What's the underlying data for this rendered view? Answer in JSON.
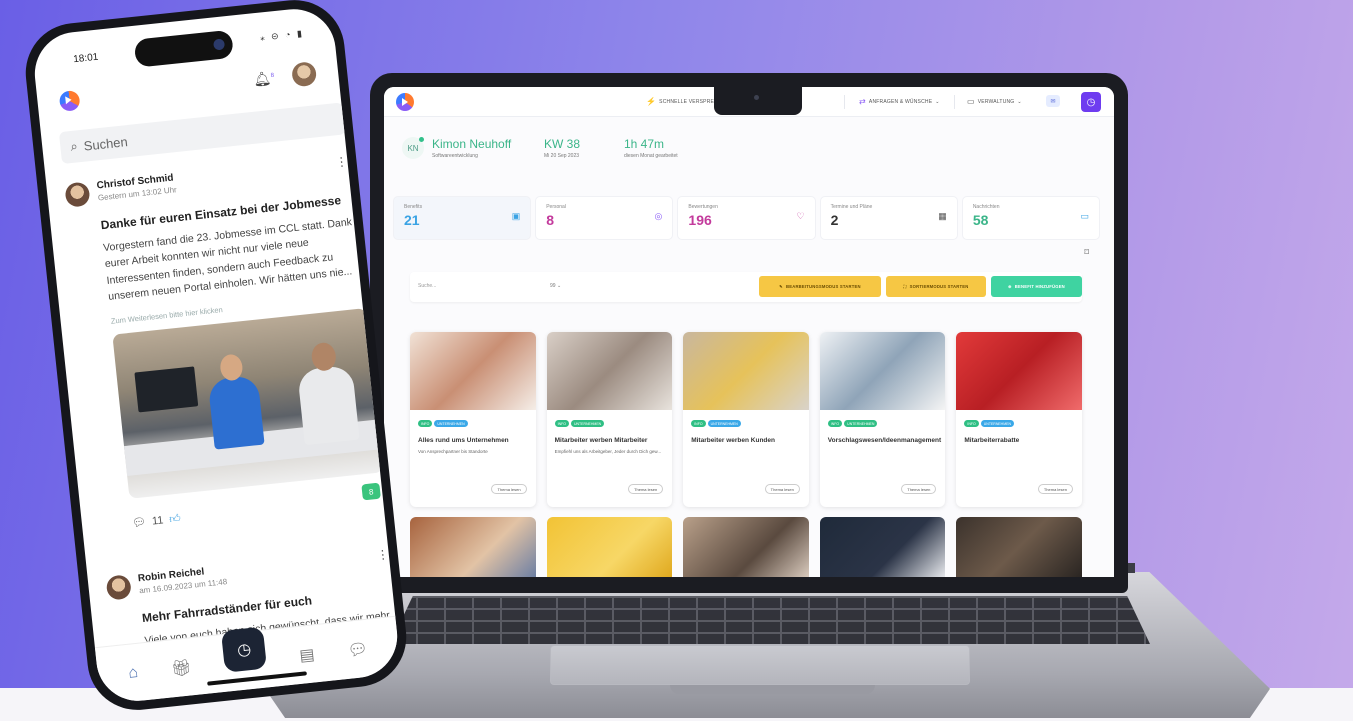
{
  "laptop": {
    "topbar": {
      "item1": "SCHNELLE VERSPRECHEN",
      "item2": "ANFRAGEN & WÜNSCHE",
      "item3": "VERWALTUNG",
      "item3_chevron": "⌄",
      "item2_chevron": "⌄",
      "btn_icon": "clock-icon"
    },
    "profile": {
      "initials": "KN",
      "name": "Kimon Neuhoff",
      "role": "Softwareentwicklung",
      "week": "KW 38",
      "date": "Mi 20 Sep 2023",
      "hours": "1h 47m",
      "hours_label": "diesen Monat gearbeitet"
    },
    "stats": [
      {
        "label": "Benefits",
        "value": "21",
        "color": "#3aa3e4",
        "icon": "gift-icon"
      },
      {
        "label": "Personal",
        "value": "8",
        "color": "#c33a9c",
        "icon": "person-icon"
      },
      {
        "label": "Bewertungen",
        "value": "196",
        "color": "#c33a9c",
        "icon": "heart-icon"
      },
      {
        "label": "Termine und Pläne",
        "value": "2",
        "color": "#333333",
        "icon": "calendar-icon"
      },
      {
        "label": "Nachrichten",
        "value": "58",
        "color": "#3bb589",
        "icon": "chat-icon"
      }
    ],
    "toolbar": {
      "search_placeholder": "Suche...",
      "select_label": "99 ⌄",
      "btn_edit": "BEARBEITUNGSMODUS STARTEN",
      "btn_sort": "SORTIERMODUS STARTEN",
      "btn_add": "BENEFIT HINZUFÜGEN"
    },
    "cards": [
      {
        "title": "Alles rund ums Unternehmen",
        "desc": "Von Ansprechpartner bis Standorte",
        "btn": "Thema lesen"
      },
      {
        "title": "Mitarbeiter werben Mitarbeiter",
        "desc": "Empfiehl uns als Arbeitgeber, Jeder durch Dich gew...",
        "btn": "Thema lesen"
      },
      {
        "title": "Mitarbeiter werben Kunden",
        "desc": "",
        "btn": "Thema lesen"
      },
      {
        "title": "Vorschlagswesen/Ideenmanagement",
        "desc": "",
        "btn": "Thema lesen"
      },
      {
        "title": "Mitarbeiterrabatte",
        "desc": "",
        "btn": "Thema lesen"
      }
    ],
    "tag_a": "INFO",
    "tag_b": "UNTERNEHMEN"
  },
  "phone": {
    "time": "18:01",
    "status_icons": "⁎ ⊝ ◔ ▮",
    "bell_count": "8",
    "search_placeholder": "Suchen",
    "post1": {
      "author": "Christof Schmid",
      "time": "Gestern um 13:02 Uhr",
      "title": "Danke für euren Einsatz bei der Jobmesse",
      "text": "Vorgestern fand die 23. Jobmesse im CCL statt. Dank eurer Arbeit konnten wir nicht nur viele neue Interessenten finden, sondern auch Feedback zu unserem neuen Portal einholen. Wir hätten uns nie...",
      "link": "Zum Weiterlesen bitte hier klicken",
      "comments": "11",
      "chat_count": "8"
    },
    "post2": {
      "author": "Robin Reichel",
      "time": "am 16.09.2023 um 11:48",
      "title": "Mehr Fahrradständer für euch",
      "text": "Viele von euch haben sich gewünscht, dass wir mehr"
    },
    "tabs": [
      "home-icon",
      "gift-icon",
      "clock-icon",
      "calendar-icon",
      "chat-icon"
    ]
  }
}
